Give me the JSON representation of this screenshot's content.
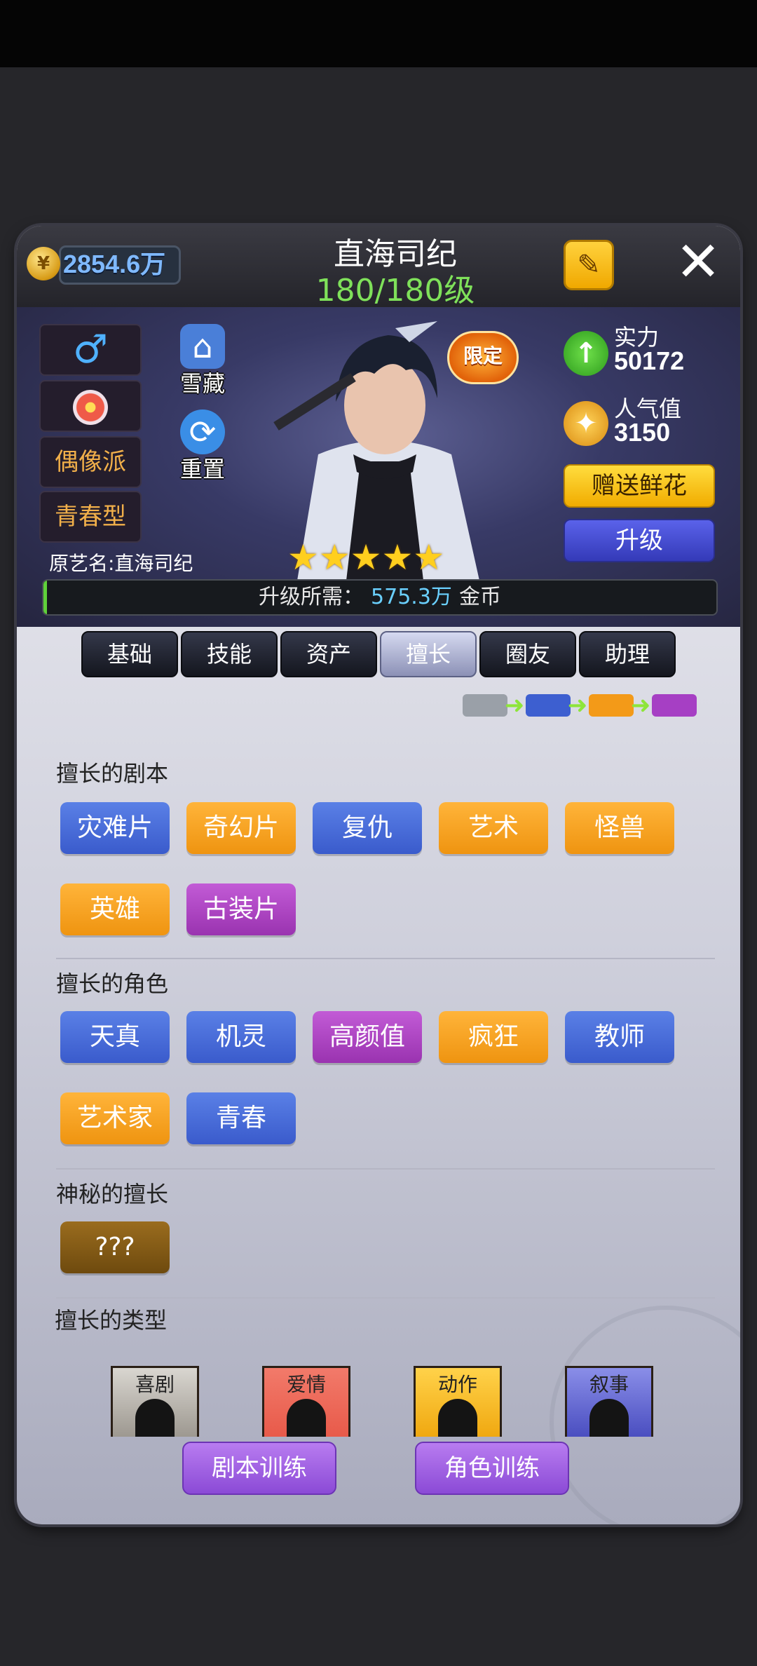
{
  "header": {
    "coins": "2854.6万",
    "name": "直海司纪",
    "level": "180/180级"
  },
  "hero": {
    "attributes": [
      "偶像派",
      "青春型"
    ],
    "original_name": "原艺名:直海司纪",
    "side_icons": [
      {
        "label": "雪藏",
        "icon": "house-icon"
      },
      {
        "label": "重置",
        "icon": "refresh-icon"
      }
    ],
    "limited_badge": "限定",
    "stars": 5,
    "power_label": "实力",
    "power_value": "50172",
    "popularity_label": "人气值",
    "popularity_value": "3150",
    "gift_flower_button": "赠送鲜花",
    "upgrade_button": "升级",
    "upgrade_req_label": "升级所需：",
    "upgrade_req_amount": "575.3万",
    "upgrade_req_unit": "金币",
    "upgrade_progress": 0.005
  },
  "tabs": [
    "基础",
    "技能",
    "资产",
    "擅长",
    "圈友",
    "助理"
  ],
  "active_tab": "擅长",
  "tier_chain_colors": [
    "#9aa0a8",
    "#3d5fd0",
    "#f39a18",
    "#a63fc4"
  ],
  "sections": {
    "scripts_title": "擅长的剧本",
    "scripts": [
      {
        "label": "灾难片",
        "color": "blue"
      },
      {
        "label": "奇幻片",
        "color": "orange"
      },
      {
        "label": "复仇",
        "color": "blue"
      },
      {
        "label": "艺术",
        "color": "orange"
      },
      {
        "label": "怪兽",
        "color": "orange"
      },
      {
        "label": "英雄",
        "color": "orange"
      },
      {
        "label": "古装片",
        "color": "purple"
      }
    ],
    "roles_title": "擅长的角色",
    "roles": [
      {
        "label": "天真",
        "color": "blue"
      },
      {
        "label": "机灵",
        "color": "blue"
      },
      {
        "label": "高颜值",
        "color": "purple"
      },
      {
        "label": "疯狂",
        "color": "orange"
      },
      {
        "label": "教师",
        "color": "blue"
      },
      {
        "label": "艺术家",
        "color": "orange"
      },
      {
        "label": "青春",
        "color": "blue"
      }
    ],
    "mystery_title": "神秘的擅长",
    "mystery_tag": "???",
    "types_title": "擅长的类型",
    "types": [
      "喜剧",
      "爱情",
      "动作",
      "叙事"
    ]
  },
  "buttons": {
    "script_training": "剧本训练",
    "role_training": "角色训练"
  }
}
